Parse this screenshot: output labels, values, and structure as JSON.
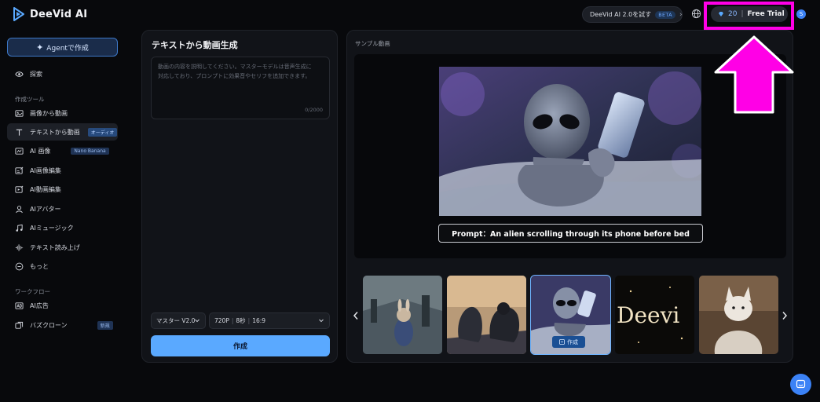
{
  "header": {
    "logo_text": "DeeVid AI",
    "try_label": "DeeVid AI 2.0を試す",
    "beta_badge": "BETA",
    "credits": "20",
    "separator": "|",
    "free_trial": "Free Trial",
    "avatar_letter": "S"
  },
  "sidebar": {
    "agent_button": "Agentで作成",
    "explore": "探索",
    "section_tools": "作成ツール",
    "section_workflow": "ワークフロー",
    "items": [
      {
        "label": "画像から動画",
        "tag": ""
      },
      {
        "label": "テキストから動画",
        "tag": "オーディオ"
      },
      {
        "label": "AI 画像",
        "tag": "Nano Banana"
      },
      {
        "label": "AI画像編集",
        "tag": ""
      },
      {
        "label": "AI動画編集",
        "tag": ""
      },
      {
        "label": "AIアバター",
        "tag": ""
      },
      {
        "label": "AIミュージック",
        "tag": ""
      },
      {
        "label": "テキスト読み上げ",
        "tag": ""
      },
      {
        "label": "もっと",
        "tag": ""
      }
    ],
    "workflow_items": [
      {
        "label": "AI広告",
        "tag": ""
      },
      {
        "label": "バズクローン",
        "tag": "新規"
      }
    ]
  },
  "editor": {
    "title": "テキストから動画生成",
    "placeholder_line1": "動画の内容を説明してください。マスターモデルは音声生成に",
    "placeholder_line2": "対応しており、プロンプトに効果音やセリフを追加できます。",
    "char_count": "0/2000",
    "model": "マスター V2.0",
    "resolution": "720P",
    "duration": "8秒",
    "ratio": "16:9",
    "create_button": "作成"
  },
  "sample": {
    "label": "サンプル動画",
    "prompt": "Prompt：An alien scrolling through its phone before bed",
    "thumb_create": "作成",
    "thumb_text": "Deevi"
  },
  "colors": {
    "accent": "#5aa9ff",
    "highlight": "#ff00e6",
    "background": "#08090c",
    "panel": "#111318"
  }
}
